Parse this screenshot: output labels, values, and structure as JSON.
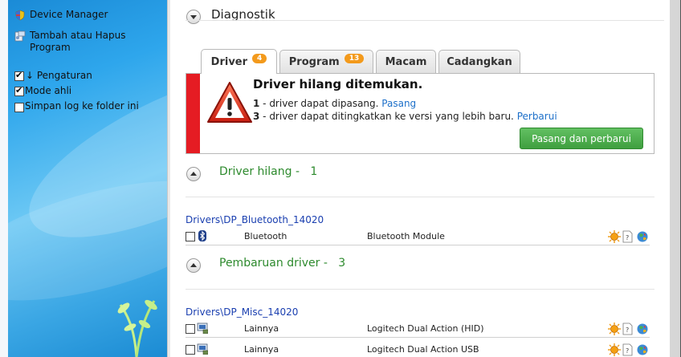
{
  "left_panel": {
    "items": [
      {
        "label": "Device Manager",
        "icon": "shield-icon"
      },
      {
        "label": "Tambah atau Hapus Program",
        "icon": "programs-icon"
      }
    ],
    "settings": {
      "header": "↓ Pengaturan",
      "header_checked": true,
      "options": [
        {
          "label": "Mode ahli",
          "checked": true
        },
        {
          "label": "Simpan log ke folder ini",
          "checked": false
        }
      ]
    }
  },
  "diagnostic": {
    "title": "Diagnostik"
  },
  "tabs": [
    {
      "label": "Driver",
      "badge": "4",
      "active": true
    },
    {
      "label": "Program",
      "badge": "13",
      "active": false
    },
    {
      "label": "Macam",
      "badge": "",
      "active": false
    },
    {
      "label": "Cadangkan",
      "badge": "",
      "active": false
    }
  ],
  "alert": {
    "title": "Driver hilang ditemukan.",
    "line1_count": "1",
    "line1_text": " - driver dapat dipasang. ",
    "line1_link": "Pasang",
    "line2_count": "3",
    "line2_text": " - driver dapat ditingkatkan ke versi yang lebih baru. ",
    "line2_link": "Perbarui",
    "button": "Pasang dan perbarui"
  },
  "sections": [
    {
      "title": "Driver hilang -   1",
      "groups": [
        {
          "path": "Drivers\\DP_Bluetooth_14020",
          "rows": [
            {
              "name": "Bluetooth",
              "description": "Bluetooth Module",
              "icon": "bluetooth-icon"
            }
          ]
        }
      ]
    },
    {
      "title": "Pembaruan driver -   3",
      "groups": [
        {
          "path": "Drivers\\DP_Misc_14020",
          "rows": [
            {
              "name": "Lainnya",
              "description": "Logitech Dual Action (HID)",
              "icon": "device-icon"
            },
            {
              "name": "Lainnya",
              "description": "Logitech Dual Action USB",
              "icon": "device-icon"
            }
          ]
        }
      ]
    }
  ],
  "colors": {
    "accent_green": "#2d8a2d",
    "badge_orange": "#f39a1c",
    "alert_red": "#e51c23",
    "link_blue": "#1c6fc9",
    "group_blue": "#1a3fb0"
  }
}
